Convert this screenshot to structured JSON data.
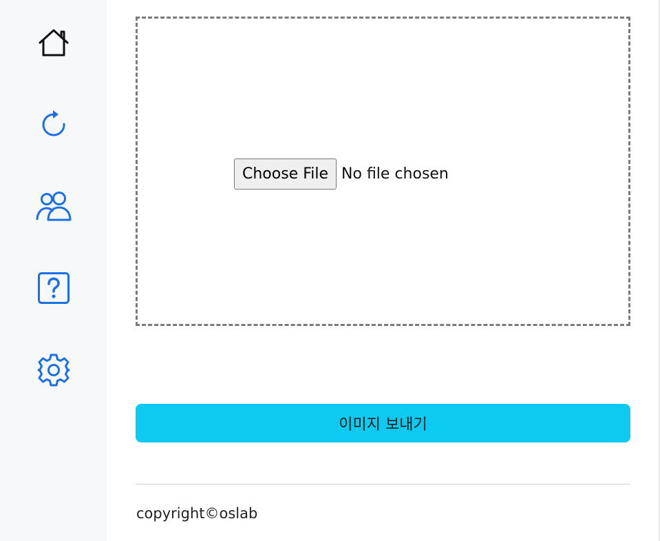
{
  "sidebar": {
    "items": [
      {
        "icon": "home-icon",
        "color": "#111111"
      },
      {
        "icon": "refresh-icon",
        "color": "#1a6fe8"
      },
      {
        "icon": "people-icon",
        "color": "#1a6fe8"
      },
      {
        "icon": "question-square-icon",
        "color": "#1a6fe8"
      },
      {
        "icon": "gear-icon",
        "color": "#1a6fe8"
      }
    ]
  },
  "upload": {
    "choose_label": "Choose File",
    "status": "No file chosen"
  },
  "send_button": {
    "label": "이미지 보내기",
    "color": "#0dcaf0"
  },
  "footer": {
    "copyright": "copyright©oslab"
  }
}
